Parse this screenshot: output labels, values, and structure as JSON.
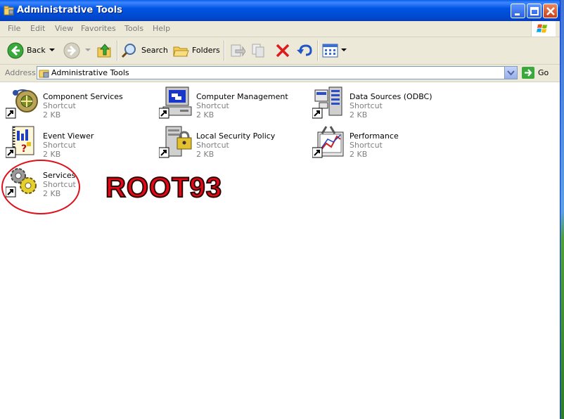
{
  "window": {
    "title": "Administrative Tools"
  },
  "menu": [
    "File",
    "Edit",
    "View",
    "Favorites",
    "Tools",
    "Help"
  ],
  "toolbar": {
    "back_label": "Back",
    "search_label": "Search",
    "folders_label": "Folders"
  },
  "address": {
    "label": "Address",
    "value": "Administrative Tools",
    "go_label": "Go"
  },
  "items": [
    {
      "name": "Component Services",
      "type": "Shortcut",
      "size": "2 KB",
      "icon": "component-services-icon"
    },
    {
      "name": "Computer Management",
      "type": "Shortcut",
      "size": "2 KB",
      "icon": "computer-management-icon"
    },
    {
      "name": "Data Sources (ODBC)",
      "type": "Shortcut",
      "size": "2 KB",
      "icon": "data-sources-icon"
    },
    {
      "name": "Event Viewer",
      "type": "Shortcut",
      "size": "2 KB",
      "icon": "event-viewer-icon"
    },
    {
      "name": "Local Security Policy",
      "type": "Shortcut",
      "size": "2 KB",
      "icon": "local-security-policy-icon"
    },
    {
      "name": "Performance",
      "type": "Shortcut",
      "size": "2 KB",
      "icon": "performance-icon"
    },
    {
      "name": "Services",
      "type": "Shortcut",
      "size": "2 KB",
      "icon": "services-icon"
    }
  ],
  "watermark": "ROOT93",
  "colors": {
    "titlebar": "#0054e3",
    "chrome": "#ece9d8",
    "annotation": "#e30a17"
  }
}
